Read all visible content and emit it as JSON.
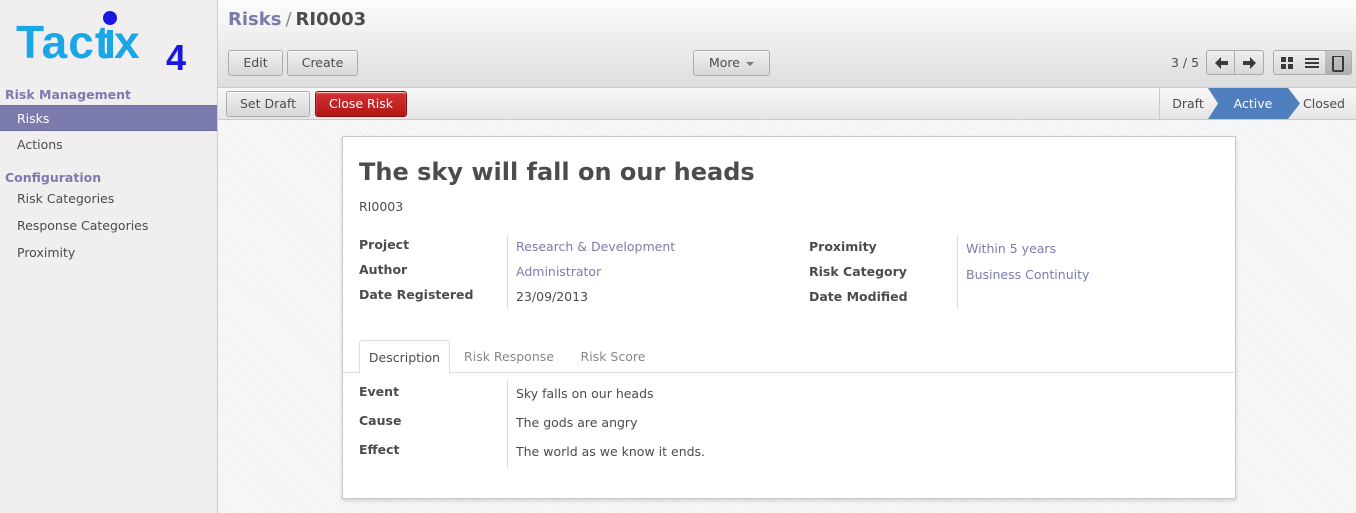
{
  "sidebar": {
    "logo": {
      "text": "Tactix",
      "subscript": "4",
      "colors": {
        "text": "#1aa7e8",
        "dot": "#1a18e0",
        "four": "#1a18e0"
      }
    },
    "sections": [
      {
        "title": "Risk Management",
        "items": [
          {
            "label": "Risks",
            "active": true
          },
          {
            "label": "Actions",
            "active": false
          }
        ]
      },
      {
        "title": "Configuration",
        "items": [
          {
            "label": "Risk Categories"
          },
          {
            "label": "Response Categories"
          },
          {
            "label": "Proximity"
          }
        ]
      }
    ]
  },
  "header": {
    "breadcrumb": {
      "parent": "Risks",
      "separator": "/",
      "current": "RI0003"
    },
    "buttons": {
      "edit": "Edit",
      "create": "Create",
      "more": "More"
    },
    "pager": {
      "text": "3 / 5"
    },
    "views": [
      "kanban-icon",
      "list-icon",
      "form-icon"
    ]
  },
  "statusbar": {
    "buttons": {
      "set_draft": "Set Draft",
      "close_risk": "Close Risk"
    },
    "stages": [
      {
        "label": "Draft",
        "active": false
      },
      {
        "label": "Active",
        "active": true
      },
      {
        "label": "Closed",
        "active": false
      }
    ],
    "colors": {
      "active_stage": "#4f7fbf",
      "close_button": "#c11e1e"
    }
  },
  "record": {
    "title": "The sky will fall on our heads",
    "reference": "RI0003",
    "left_fields": [
      {
        "label": "Project",
        "value": "Research & Development",
        "link": true
      },
      {
        "label": "Author",
        "value": "Administrator",
        "link": true
      },
      {
        "label": "Date Registered",
        "value": "23/09/2013",
        "link": false
      }
    ],
    "right_fields": [
      {
        "label": "Proximity",
        "value": "Within 5 years",
        "link": true
      },
      {
        "label": "Risk Category",
        "value": "Business Continuity",
        "link": true
      },
      {
        "label": "Date Modified",
        "value": "",
        "link": false
      }
    ],
    "tabs": [
      {
        "label": "Description",
        "active": true
      },
      {
        "label": "Risk Response",
        "active": false
      },
      {
        "label": "Risk Score",
        "active": false
      }
    ],
    "description": [
      {
        "label": "Event",
        "value": "Sky falls on our heads"
      },
      {
        "label": "Cause",
        "value": "The gods are angry"
      },
      {
        "label": "Effect",
        "value": "The world as we know it ends."
      }
    ]
  }
}
